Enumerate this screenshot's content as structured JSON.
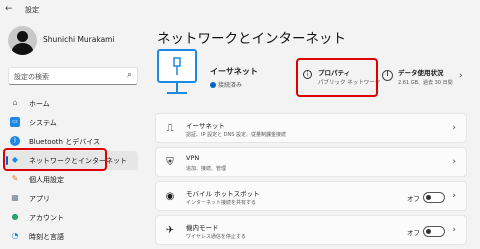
{
  "window": {
    "back_glyph": "←",
    "title": "設定"
  },
  "user": {
    "name": "Shunichi Murakami"
  },
  "search": {
    "placeholder": "設定の検索",
    "icon": "search-icon"
  },
  "sidebar": {
    "items": [
      {
        "label": "ホーム",
        "icon": "home-icon",
        "color": "#7a7a7a",
        "active": false
      },
      {
        "label": "システム",
        "icon": "system-icon",
        "color": "#1e88e5",
        "active": false
      },
      {
        "label": "Bluetooth とデバイス",
        "icon": "bluetooth-icon",
        "color": "#1e88e5",
        "active": false
      },
      {
        "label": "ネットワークとインターネット",
        "icon": "wifi-icon",
        "color": "#1e88e5",
        "active": true
      },
      {
        "label": "個人用設定",
        "icon": "brush-icon",
        "color": "#e07a2a",
        "active": false
      },
      {
        "label": "アプリ",
        "icon": "apps-icon",
        "color": "#6a7a8a",
        "active": false
      },
      {
        "label": "アカウント",
        "icon": "account-icon",
        "color": "#2aa36b",
        "active": false
      },
      {
        "label": "時刻と言語",
        "icon": "time-language-icon",
        "color": "#1e88e5",
        "active": false
      }
    ]
  },
  "main": {
    "title": "ネットワークとインターネット",
    "hero": {
      "title": "イーサネット",
      "status": "接続済み"
    },
    "properties": {
      "title": "プロパティ",
      "subtitle": "パブリック ネットワーク"
    },
    "usage": {
      "title": "データ使用状況",
      "subtitle": "2.61 GB、過去 30 日間"
    },
    "cards": [
      {
        "title": "イーサネット",
        "subtitle": "認証、IP 設定と DNS 設定、従量制課金接続",
        "icon": "ethernet-icon",
        "control": "chevron"
      },
      {
        "title": "VPN",
        "subtitle": "追加、接続、管理",
        "icon": "vpn-icon",
        "control": "chevron"
      },
      {
        "title": "モバイル ホットスポット",
        "subtitle": "インターネット接続を共有する",
        "icon": "hotspot-icon",
        "control": "toggle",
        "toggle_label": "オフ"
      },
      {
        "title": "機内モード",
        "subtitle": "ワイヤレス通信を停止する",
        "icon": "airplane-icon",
        "control": "toggle",
        "toggle_label": "オフ"
      }
    ]
  },
  "colors": {
    "accent": "#0067c0",
    "highlight": "#e00000"
  }
}
